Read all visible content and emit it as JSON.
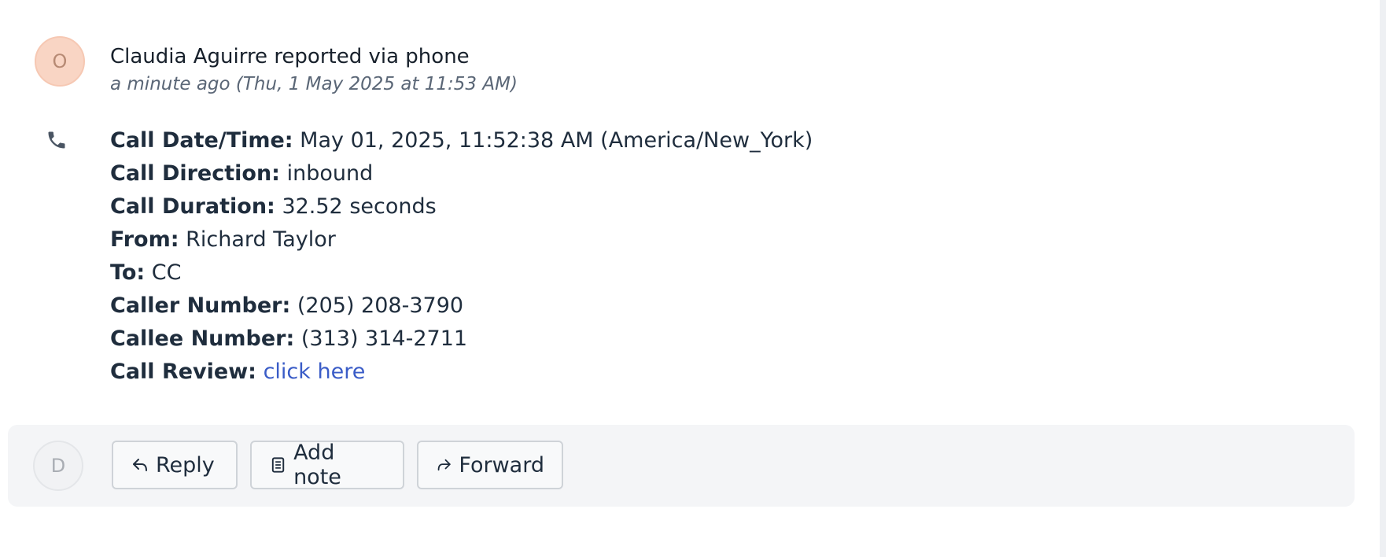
{
  "activity": {
    "avatar_initial": "O",
    "title": "Claudia Aguirre reported via phone",
    "time": "a minute ago (Thu, 1 May 2025 at 11:53 AM)",
    "avatar_color": "#f9d5c4"
  },
  "call": {
    "icon": "phone-icon",
    "rows": [
      {
        "label": "Call Date/Time:",
        "value": "May 01, 2025, 11:52:38 AM (America/New_York)"
      },
      {
        "label": "Call Direction:",
        "value": "inbound"
      },
      {
        "label": "Call Duration:",
        "value": "32.52 seconds"
      },
      {
        "label": "From:",
        "value": "Richard Taylor"
      },
      {
        "label": "To:",
        "value": "CC"
      },
      {
        "label": "Caller Number:",
        "value": "(205) 208-3790"
      },
      {
        "label": "Callee Number:",
        "value": "(313) 314-2711"
      },
      {
        "label": "Call Review:",
        "value": "click here",
        "is_link": true
      }
    ],
    "link_color": "#3a5cc7"
  },
  "actions": {
    "avatar_initial": "D",
    "reply_label": "Reply",
    "reply_icon": "reply-icon",
    "note_label": "Add note",
    "note_icon": "note-icon",
    "forward_label": "Forward",
    "forward_icon": "forward-icon"
  }
}
